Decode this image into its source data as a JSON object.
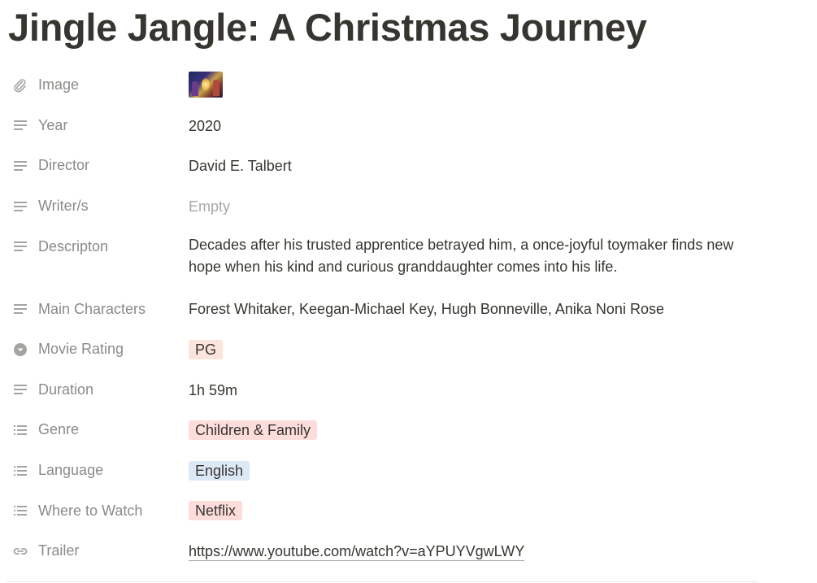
{
  "page": {
    "title": "Jingle Jangle: A Christmas Journey"
  },
  "properties": [
    {
      "key": "image",
      "label": "Image",
      "icon": "paperclip-icon",
      "type": "image"
    },
    {
      "key": "year",
      "label": "Year",
      "icon": "text-icon",
      "type": "text",
      "value": "2020"
    },
    {
      "key": "director",
      "label": "Director",
      "icon": "text-icon",
      "type": "text",
      "value": "David E. Talbert"
    },
    {
      "key": "writers",
      "label": "Writer/s",
      "icon": "text-icon",
      "type": "empty",
      "value": "Empty"
    },
    {
      "key": "description",
      "label": "Descripton",
      "icon": "text-icon",
      "type": "desc",
      "value": "Decades after his trusted apprentice betrayed him, a once-joyful toymaker finds new hope when his kind and curious granddaughter comes into his life."
    },
    {
      "key": "main_characters",
      "label": "Main Characters",
      "icon": "text-icon",
      "type": "text",
      "value": "Forest Whitaker, Keegan-Michael Key, Hugh Bonneville, Anika Noni Rose"
    },
    {
      "key": "movie_rating",
      "label": "Movie Rating",
      "icon": "select-icon",
      "type": "tag",
      "value": "PG",
      "color": "#fbe4dc"
    },
    {
      "key": "duration",
      "label": "Duration",
      "icon": "text-icon",
      "type": "text",
      "value": "1h 59m"
    },
    {
      "key": "genre",
      "label": "Genre",
      "icon": "list-icon",
      "type": "tag",
      "value": "Children & Family",
      "color": "#fddcdc"
    },
    {
      "key": "language",
      "label": "Language",
      "icon": "list-icon",
      "type": "tag",
      "value": "English",
      "color": "#dde8f6"
    },
    {
      "key": "where_to_watch",
      "label": "Where to Watch",
      "icon": "list-icon",
      "type": "tag",
      "value": "Netflix",
      "color": "#fddcdc"
    },
    {
      "key": "trailer",
      "label": "Trailer",
      "icon": "link-icon",
      "type": "link",
      "value": "https://www.youtube.com/watch?v=aYPUYVgwLWY"
    }
  ]
}
